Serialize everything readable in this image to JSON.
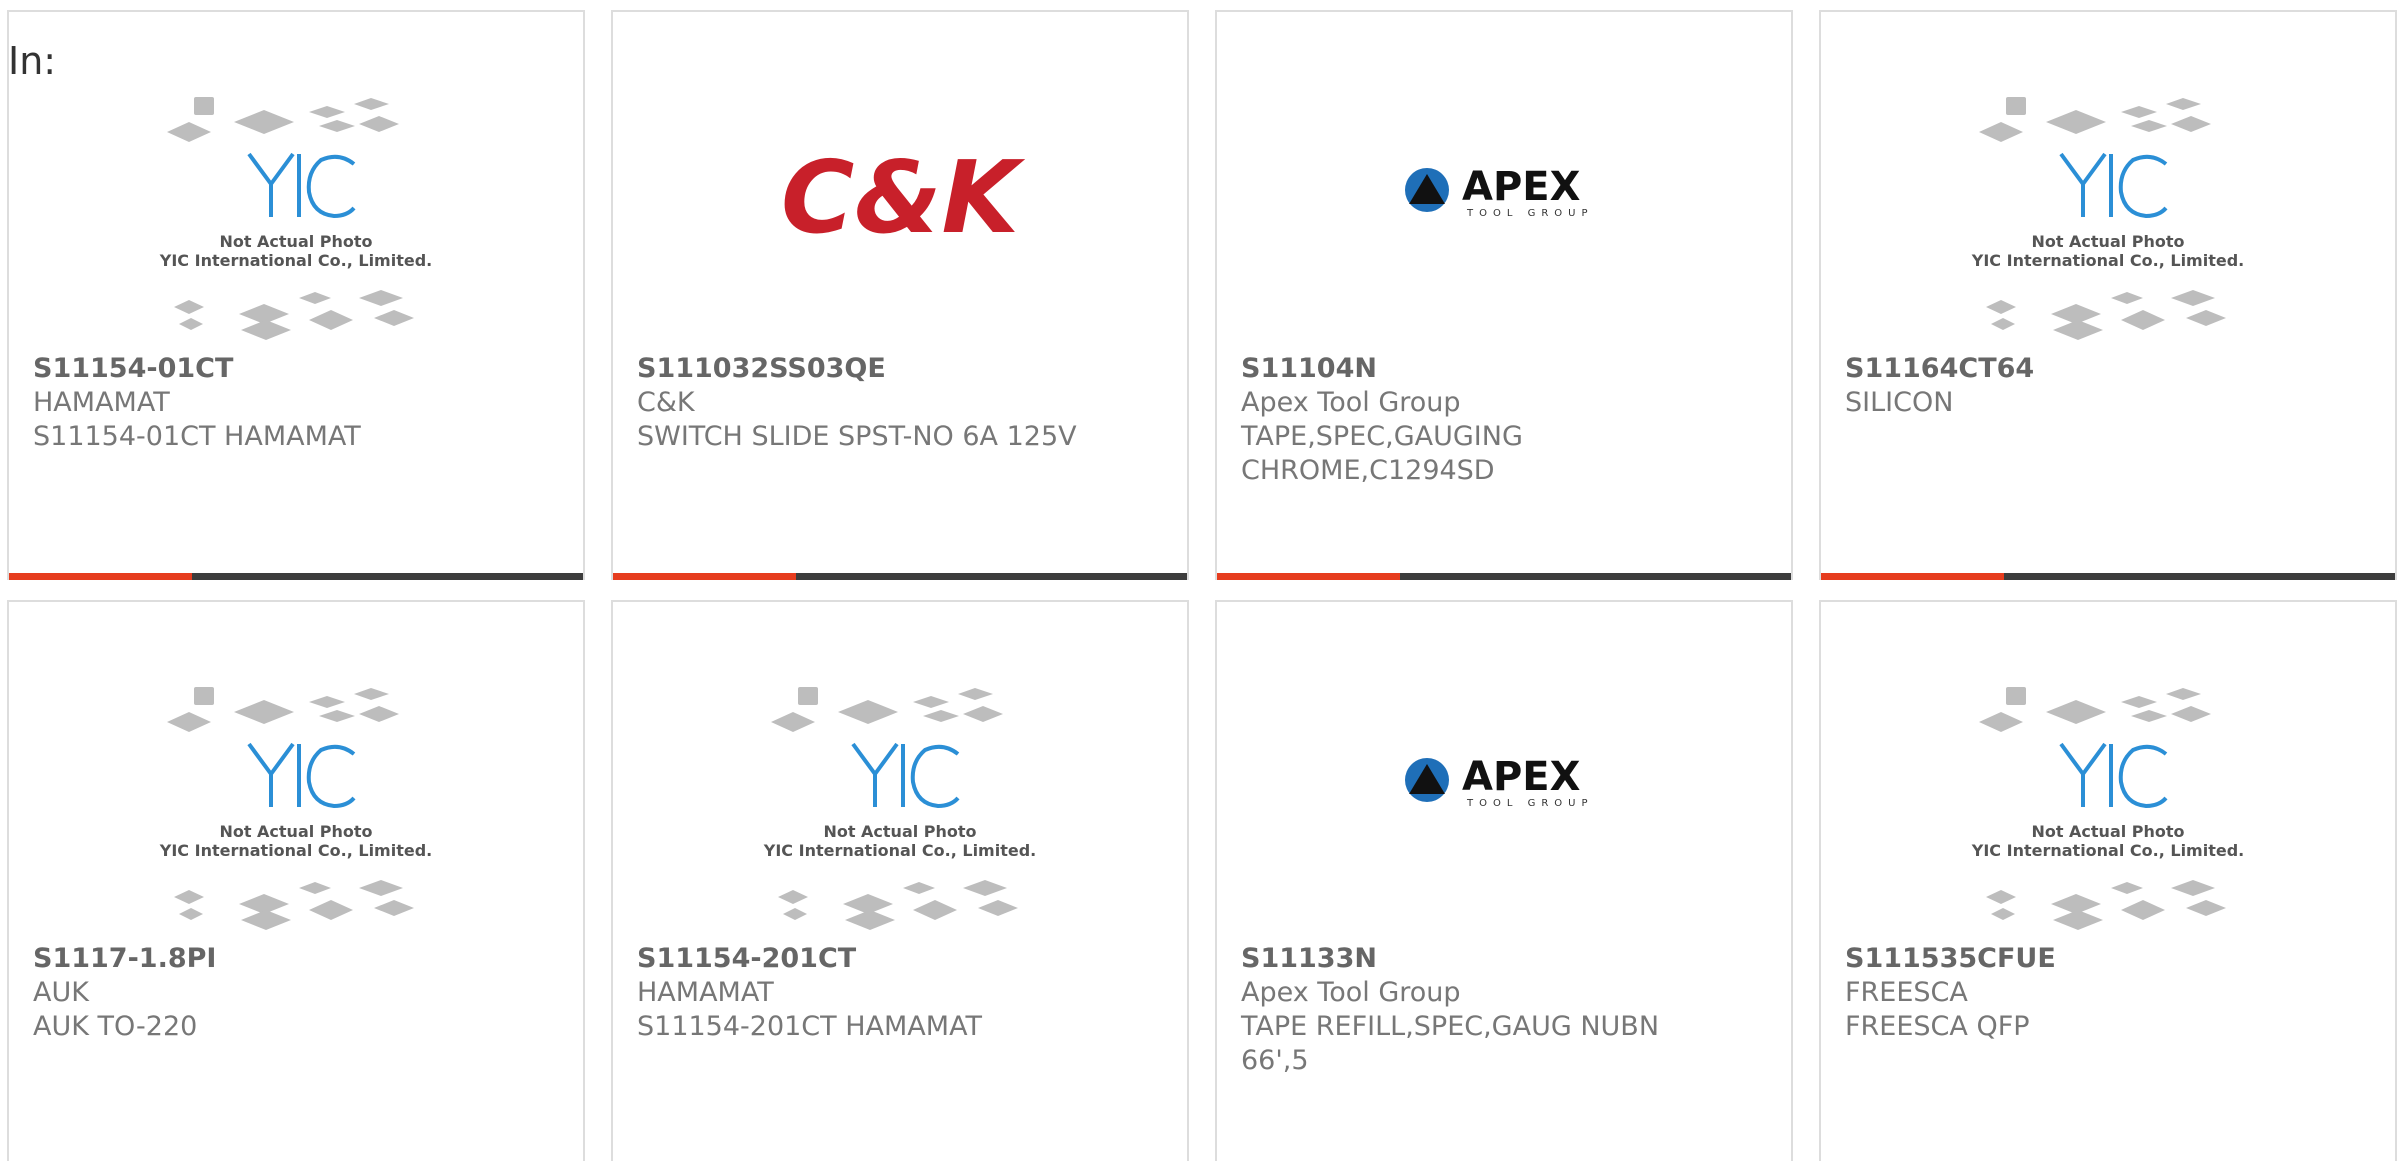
{
  "header": {
    "label": "In:"
  },
  "products": [
    {
      "part_number": "S11154-01CT",
      "manufacturer": "HAMAMAT",
      "description": "S11154-01CT HAMAMAT",
      "image": "placeholder-yic"
    },
    {
      "part_number": "S111032SS03QE",
      "manufacturer": "C&K",
      "description": "SWITCH SLIDE SPST-NO 6A 125V",
      "image": "ck-logo"
    },
    {
      "part_number": "S11104N",
      "manufacturer": "Apex Tool Group",
      "description": "TAPE,SPEC,GAUGING",
      "description2": "CHROME,C1294SD",
      "image": "apex-logo"
    },
    {
      "part_number": "S11164CT64",
      "manufacturer": "SILICON",
      "description": "",
      "image": "placeholder-yic"
    },
    {
      "part_number": "S1117-1.8PI",
      "manufacturer": "AUK",
      "description": "AUK TO-220",
      "image": "placeholder-yic"
    },
    {
      "part_number": "S11154-201CT",
      "manufacturer": "HAMAMAT",
      "description": "S11154-201CT HAMAMAT",
      "image": "placeholder-yic"
    },
    {
      "part_number": "S11133N",
      "manufacturer": "Apex Tool Group",
      "description": "TAPE REFILL,SPEC,GAUG NUBN",
      "description2": "66',5",
      "image": "apex-logo"
    },
    {
      "part_number": "S111535CFUE",
      "manufacturer": "FREESCA",
      "description": "FREESCA QFP",
      "image": "placeholder-yic"
    }
  ],
  "placeholder": {
    "line1": "Not Actual Photo",
    "line2": "YIC International Co., Limited.",
    "brand": "YIC"
  },
  "logos": {
    "ck": "C&K",
    "apex": "APEX",
    "apex_sub": "TOOL GROUP"
  },
  "colors": {
    "accent": "#e63c1e",
    "footer": "#3c3c3c",
    "ck_red": "#c8202a",
    "yic_blue": "#2b8fd6"
  }
}
